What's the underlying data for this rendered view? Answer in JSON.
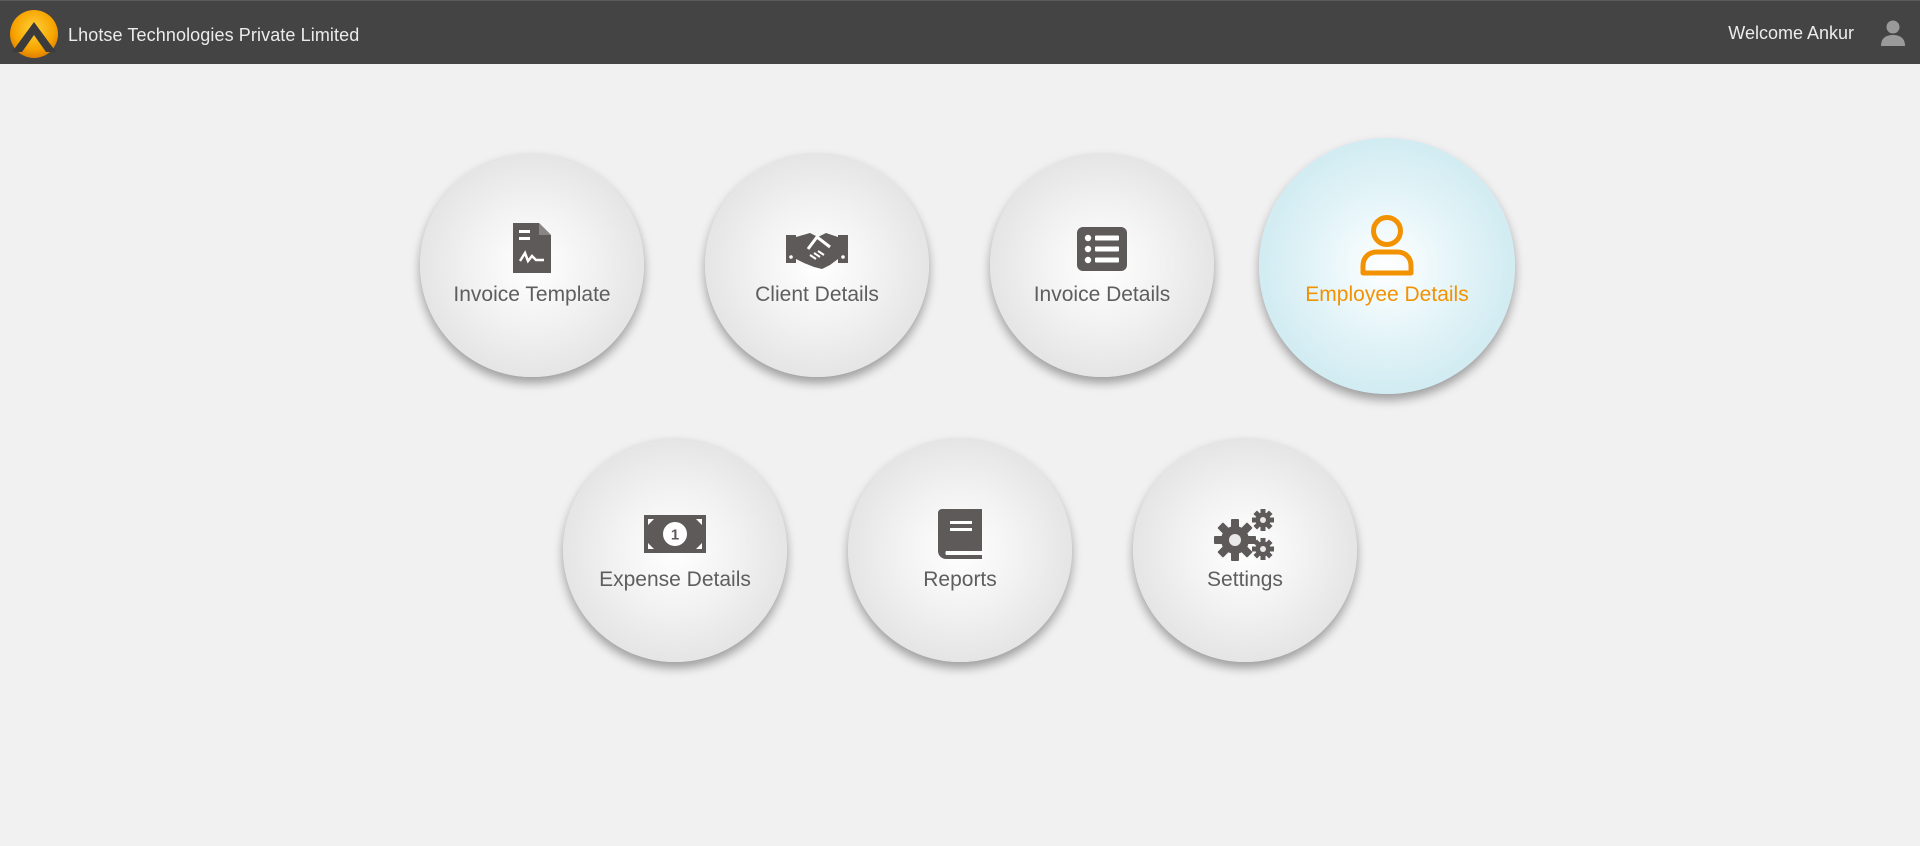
{
  "header": {
    "company_name": "Lhotse Technologies Private Limited",
    "welcome_text": "Welcome Ankur",
    "logo_icon": "mountain-logo-icon",
    "user_icon": "user-icon"
  },
  "colors": {
    "header_bg": "#444444",
    "page_bg": "#f2f1f2",
    "accent_orange": "#f39200",
    "active_tile_bg": "#c6e7ef",
    "icon_gray": "#5f5a5a",
    "label_gray": "#5e5e5e"
  },
  "tiles": [
    {
      "label": "Invoice Template",
      "icon": "signed-document-icon",
      "active": false
    },
    {
      "label": "Client Details",
      "icon": "handshake-icon",
      "active": false
    },
    {
      "label": "Invoice Details",
      "icon": "list-icon",
      "active": false
    },
    {
      "label": "Employee Details",
      "icon": "user-outline-icon",
      "active": true
    },
    {
      "label": "Expense Details",
      "icon": "money-bill-icon",
      "active": false
    },
    {
      "label": "Reports",
      "icon": "book-icon",
      "active": false
    },
    {
      "label": "Settings",
      "icon": "gears-icon",
      "active": false
    }
  ]
}
